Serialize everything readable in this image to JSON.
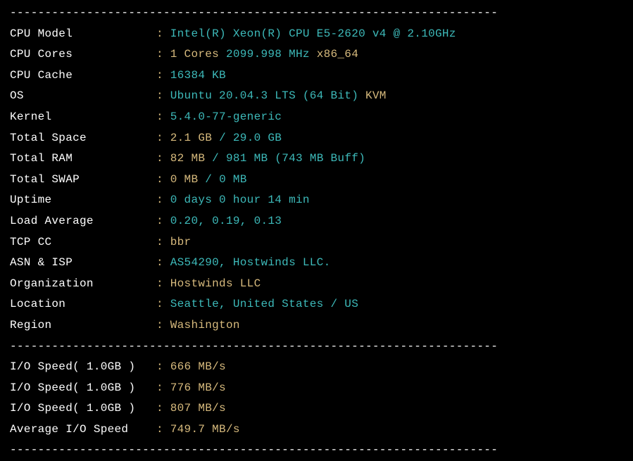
{
  "divider": "----------------------------------------------------------------------",
  "rows": [
    {
      "label": "CPU Model            ",
      "segments": [
        {
          "t": "Intel(R) Xeon(R) CPU E5-2620 v4 @ 2.10GHz",
          "c": "cyan"
        }
      ]
    },
    {
      "label": "CPU Cores            ",
      "segments": [
        {
          "t": "1 Cores",
          "c": "yellow"
        },
        {
          "t": " ",
          "c": "cyan"
        },
        {
          "t": "2099.998 MHz",
          "c": "cyan"
        },
        {
          "t": " ",
          "c": "cyan"
        },
        {
          "t": "x86_64",
          "c": "yellow"
        }
      ]
    },
    {
      "label": "CPU Cache            ",
      "segments": [
        {
          "t": "16384 KB",
          "c": "cyan"
        }
      ]
    },
    {
      "label": "OS                   ",
      "segments": [
        {
          "t": "Ubuntu 20.04.3 LTS (64 Bit)",
          "c": "cyan"
        },
        {
          "t": " ",
          "c": "cyan"
        },
        {
          "t": "KVM",
          "c": "yellow"
        }
      ]
    },
    {
      "label": "Kernel               ",
      "segments": [
        {
          "t": "5.4.0-77-generic",
          "c": "cyan"
        }
      ]
    },
    {
      "label": "Total Space          ",
      "segments": [
        {
          "t": "2.1 GB",
          "c": "yellow"
        },
        {
          "t": " / ",
          "c": "cyan"
        },
        {
          "t": "29.0 GB",
          "c": "cyan"
        }
      ]
    },
    {
      "label": "Total RAM            ",
      "segments": [
        {
          "t": "82 MB",
          "c": "yellow"
        },
        {
          "t": " / ",
          "c": "cyan"
        },
        {
          "t": "981 MB",
          "c": "cyan"
        },
        {
          "t": " (743 MB Buff)",
          "c": "cyan"
        }
      ]
    },
    {
      "label": "Total SWAP           ",
      "segments": [
        {
          "t": "0 MB",
          "c": "yellow"
        },
        {
          "t": " / ",
          "c": "cyan"
        },
        {
          "t": "0 MB",
          "c": "cyan"
        }
      ]
    },
    {
      "label": "Uptime               ",
      "segments": [
        {
          "t": "0 days 0 hour 14 min",
          "c": "cyan"
        }
      ]
    },
    {
      "label": "Load Average         ",
      "segments": [
        {
          "t": "0.20, 0.19, 0.13",
          "c": "cyan"
        }
      ]
    },
    {
      "label": "TCP CC               ",
      "segments": [
        {
          "t": "bbr",
          "c": "yellow"
        }
      ]
    },
    {
      "label": "ASN & ISP            ",
      "segments": [
        {
          "t": "AS54290, Hostwinds LLC.",
          "c": "cyan"
        }
      ]
    },
    {
      "label": "Organization         ",
      "segments": [
        {
          "t": "Hostwinds LLC",
          "c": "yellow"
        }
      ]
    },
    {
      "label": "Location             ",
      "segments": [
        {
          "t": "Seattle, United States / US",
          "c": "cyan"
        }
      ]
    },
    {
      "label": "Region               ",
      "segments": [
        {
          "t": "Washington",
          "c": "yellow"
        }
      ]
    }
  ],
  "io_rows": [
    {
      "label": "I/O Speed( 1.0GB )   ",
      "segments": [
        {
          "t": "666 MB/s",
          "c": "yellow"
        }
      ]
    },
    {
      "label": "I/O Speed( 1.0GB )   ",
      "segments": [
        {
          "t": "776 MB/s",
          "c": "yellow"
        }
      ]
    },
    {
      "label": "I/O Speed( 1.0GB )   ",
      "segments": [
        {
          "t": "807 MB/s",
          "c": "yellow"
        }
      ]
    },
    {
      "label": "Average I/O Speed    ",
      "segments": [
        {
          "t": "749.7 MB/s",
          "c": "yellow"
        }
      ]
    }
  ]
}
